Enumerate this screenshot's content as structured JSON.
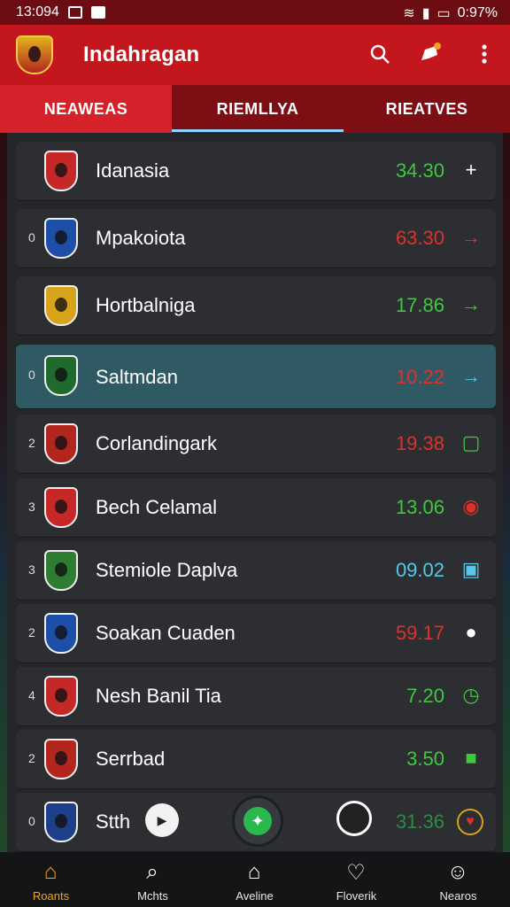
{
  "status_bar": {
    "time": "13:094",
    "battery": "0:97%"
  },
  "app_bar": {
    "title": "Indahragan"
  },
  "tabs": [
    {
      "label": "NEAWEAS",
      "active": true
    },
    {
      "label": "RIEMLLYA",
      "active": false
    },
    {
      "label": "RIEATVES",
      "active": false
    }
  ],
  "rows": [
    {
      "rank": "",
      "team": "Idanasia",
      "score": "34.30",
      "score_color": "green",
      "icon": "plus-icon",
      "glyph": "+",
      "selected": false,
      "badge_color": "#c62828"
    },
    {
      "rank": "0",
      "team": "Mpakoiota",
      "score": "63.30",
      "score_color": "red",
      "icon": "arrow-right-icon",
      "glyph": "→",
      "selected": false,
      "badge_color": "#1e4fa8"
    },
    {
      "rank": "",
      "team": "Hortbalniga",
      "score": "17.86",
      "score_color": "green",
      "icon": "arrow-right-icon",
      "glyph": "→",
      "selected": false,
      "badge_color": "#d9a21b"
    },
    {
      "rank": "0",
      "team": "Saltmdan",
      "score": "10.22",
      "score_color": "red",
      "icon": "arrow-right-icon",
      "glyph": "→",
      "selected": true,
      "badge_color": "#1f6b2e"
    },
    {
      "rank": "2",
      "team": "Corlandingark",
      "score": "19.38",
      "score_color": "red",
      "icon": "square-icon",
      "glyph": "▢",
      "selected": false,
      "badge_color": "#b3261e"
    },
    {
      "rank": "3",
      "team": "Bech Celamal",
      "score": "13.06",
      "score_color": "green",
      "icon": "pin-icon",
      "glyph": "◉",
      "selected": false,
      "badge_color": "#c62828"
    },
    {
      "rank": "3",
      "team": "Stemiole Daplva",
      "score": "09.02",
      "score_color": "blue",
      "icon": "square-dot-icon",
      "glyph": "▣",
      "selected": false,
      "badge_color": "#2e7d32"
    },
    {
      "rank": "2",
      "team": "Soakan Cuaden",
      "score": "59.17",
      "score_color": "red",
      "icon": "location-icon",
      "glyph": "●",
      "selected": false,
      "badge_color": "#1e4fa8"
    },
    {
      "rank": "4",
      "team": "Nesh Banil Tia",
      "score": "7.20",
      "score_color": "green",
      "icon": "clock-icon",
      "glyph": "◷",
      "selected": false,
      "badge_color": "#c62828"
    },
    {
      "rank": "2",
      "team": "Serrbad",
      "score": "3.50",
      "score_color": "green",
      "icon": "filled-square-icon",
      "glyph": "■",
      "selected": false,
      "badge_color": "#b3261e"
    },
    {
      "rank": "0",
      "team": "Stth",
      "score": "31.36",
      "score_color": "dim",
      "icon": "heart-icon",
      "glyph": "♥",
      "selected": false,
      "badge_color": "#1e3f8a"
    }
  ],
  "bottom_nav": [
    {
      "label": "Roants",
      "icon": "home-icon",
      "glyph": "⌂",
      "active": true
    },
    {
      "label": "Mchts",
      "icon": "search-icon",
      "glyph": "⌕",
      "active": false
    },
    {
      "label": "Aveline",
      "icon": "house-outline-icon",
      "glyph": "⌂",
      "active": false
    },
    {
      "label": "Floverik",
      "icon": "heart-outline-icon",
      "glyph": "♡",
      "active": false
    },
    {
      "label": "Nearos",
      "icon": "person-icon",
      "glyph": "☺",
      "active": false
    }
  ],
  "colors": {
    "appbar": "#c4171d",
    "tab_active": "#d4212a",
    "accent_nav": "#f3a31b",
    "score_green": "#3ec93f",
    "score_red": "#e0302a",
    "score_blue": "#56c7e6"
  }
}
